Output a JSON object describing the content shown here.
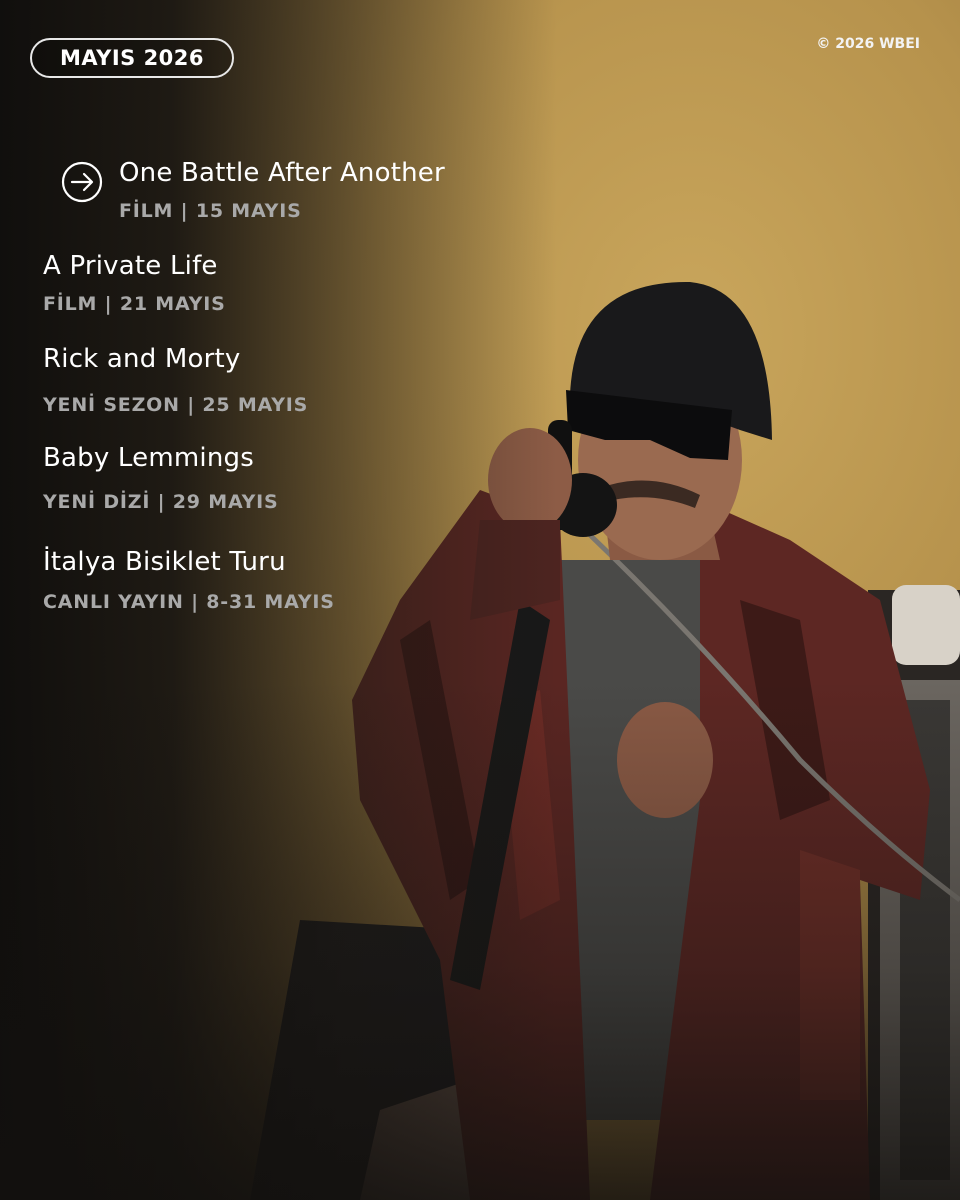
{
  "header": {
    "month_label": "MAYIS 2026",
    "copyright": "© 2026 WBEI"
  },
  "schedule": [
    {
      "title": "One Battle After Another",
      "meta": "FİLM | 15 MAYIS",
      "featured": true,
      "icon": "arrow-right-circle-icon"
    },
    {
      "title": "A Private Life",
      "meta": "FİLM | 21 MAYIS"
    },
    {
      "title": "Rick and Morty",
      "meta": "YENİ SEZON | 25 MAYIS"
    },
    {
      "title": "Baby Lemmings",
      "meta": "YENİ DİZİ | 29 MAYIS"
    },
    {
      "title": "İtalya Bisiklet Turu",
      "meta": "CANLI YAYIN | 8-31 MAYIS"
    }
  ],
  "colors": {
    "text_primary": "#ffffff",
    "text_secondary": "#a9a9a9",
    "wall": "#b6924c"
  }
}
